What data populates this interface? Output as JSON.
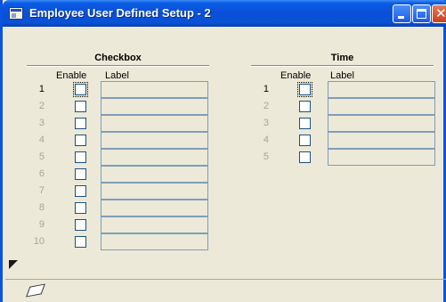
{
  "window": {
    "title": "Employee User Defined Setup - 2"
  },
  "checkbox_group": {
    "title": "Checkbox",
    "enable_header": "Enable",
    "label_header": "Label",
    "rows": [
      {
        "num": "1",
        "enabled": true,
        "checked": false,
        "label": ""
      },
      {
        "num": "2",
        "enabled": false,
        "checked": false,
        "label": ""
      },
      {
        "num": "3",
        "enabled": false,
        "checked": false,
        "label": ""
      },
      {
        "num": "4",
        "enabled": false,
        "checked": false,
        "label": ""
      },
      {
        "num": "5",
        "enabled": false,
        "checked": false,
        "label": ""
      },
      {
        "num": "6",
        "enabled": false,
        "checked": false,
        "label": ""
      },
      {
        "num": "7",
        "enabled": false,
        "checked": false,
        "label": ""
      },
      {
        "num": "8",
        "enabled": false,
        "checked": false,
        "label": ""
      },
      {
        "num": "9",
        "enabled": false,
        "checked": false,
        "label": ""
      },
      {
        "num": "10",
        "enabled": false,
        "checked": false,
        "label": ""
      }
    ]
  },
  "time_group": {
    "title": "Time",
    "enable_header": "Enable",
    "label_header": "Label",
    "rows": [
      {
        "num": "1",
        "enabled": true,
        "checked": false,
        "label": ""
      },
      {
        "num": "2",
        "enabled": false,
        "checked": false,
        "label": ""
      },
      {
        "num": "3",
        "enabled": false,
        "checked": false,
        "label": ""
      },
      {
        "num": "4",
        "enabled": false,
        "checked": false,
        "label": ""
      },
      {
        "num": "5",
        "enabled": false,
        "checked": false,
        "label": ""
      }
    ]
  },
  "colors": {
    "titlebar": "#0a4fd8",
    "frame": "#ece9d8",
    "field_border": "#7f9db9"
  },
  "icons": {
    "title": "window-app-icon",
    "status": "eraser-icon",
    "corner": "corner-marker-icon"
  }
}
